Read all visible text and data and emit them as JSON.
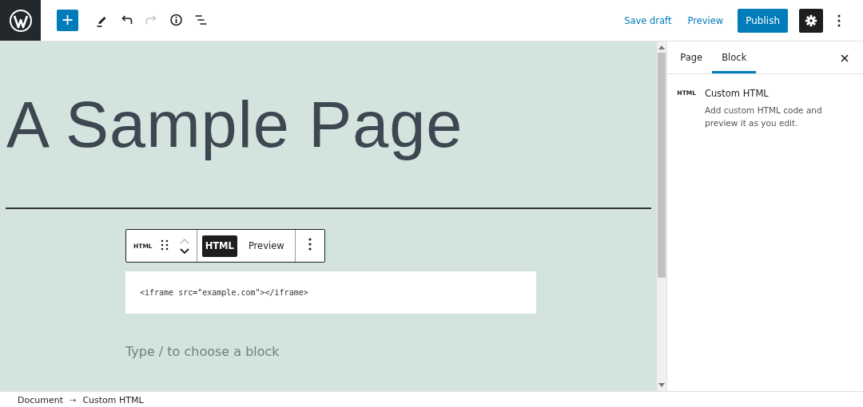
{
  "top_bar": {
    "tools": [
      {
        "kind": "add",
        "disabled": false
      },
      {
        "kind": "edit",
        "disabled": false
      },
      {
        "kind": "undo",
        "disabled": false
      },
      {
        "kind": "redo",
        "disabled": true
      },
      {
        "kind": "info",
        "disabled": false
      },
      {
        "kind": "outline",
        "disabled": false
      }
    ],
    "save_draft": "Save draft",
    "preview": "Preview",
    "publish": "Publish",
    "settings_on": true
  },
  "editor": {
    "title": "A Sample Page",
    "block_toolbar": {
      "type_label": "HTML",
      "modes": [
        {
          "label": "HTML",
          "selected": true
        },
        {
          "label": "Preview",
          "selected": false
        }
      ]
    },
    "code": "<iframe src=\"example.com\"></iframe>",
    "placeholder": "Type / to choose a block"
  },
  "sidebar": {
    "tabs": [
      {
        "label": "Page",
        "selected": false
      },
      {
        "label": "Block",
        "selected": true
      }
    ],
    "block": {
      "icon_label": "HTML",
      "name": "Custom HTML",
      "description": "Add custom HTML code and preview it as you edit."
    }
  },
  "breadcrumb": {
    "items": [
      "Document",
      "Custom HTML"
    ],
    "separator": "→"
  }
}
